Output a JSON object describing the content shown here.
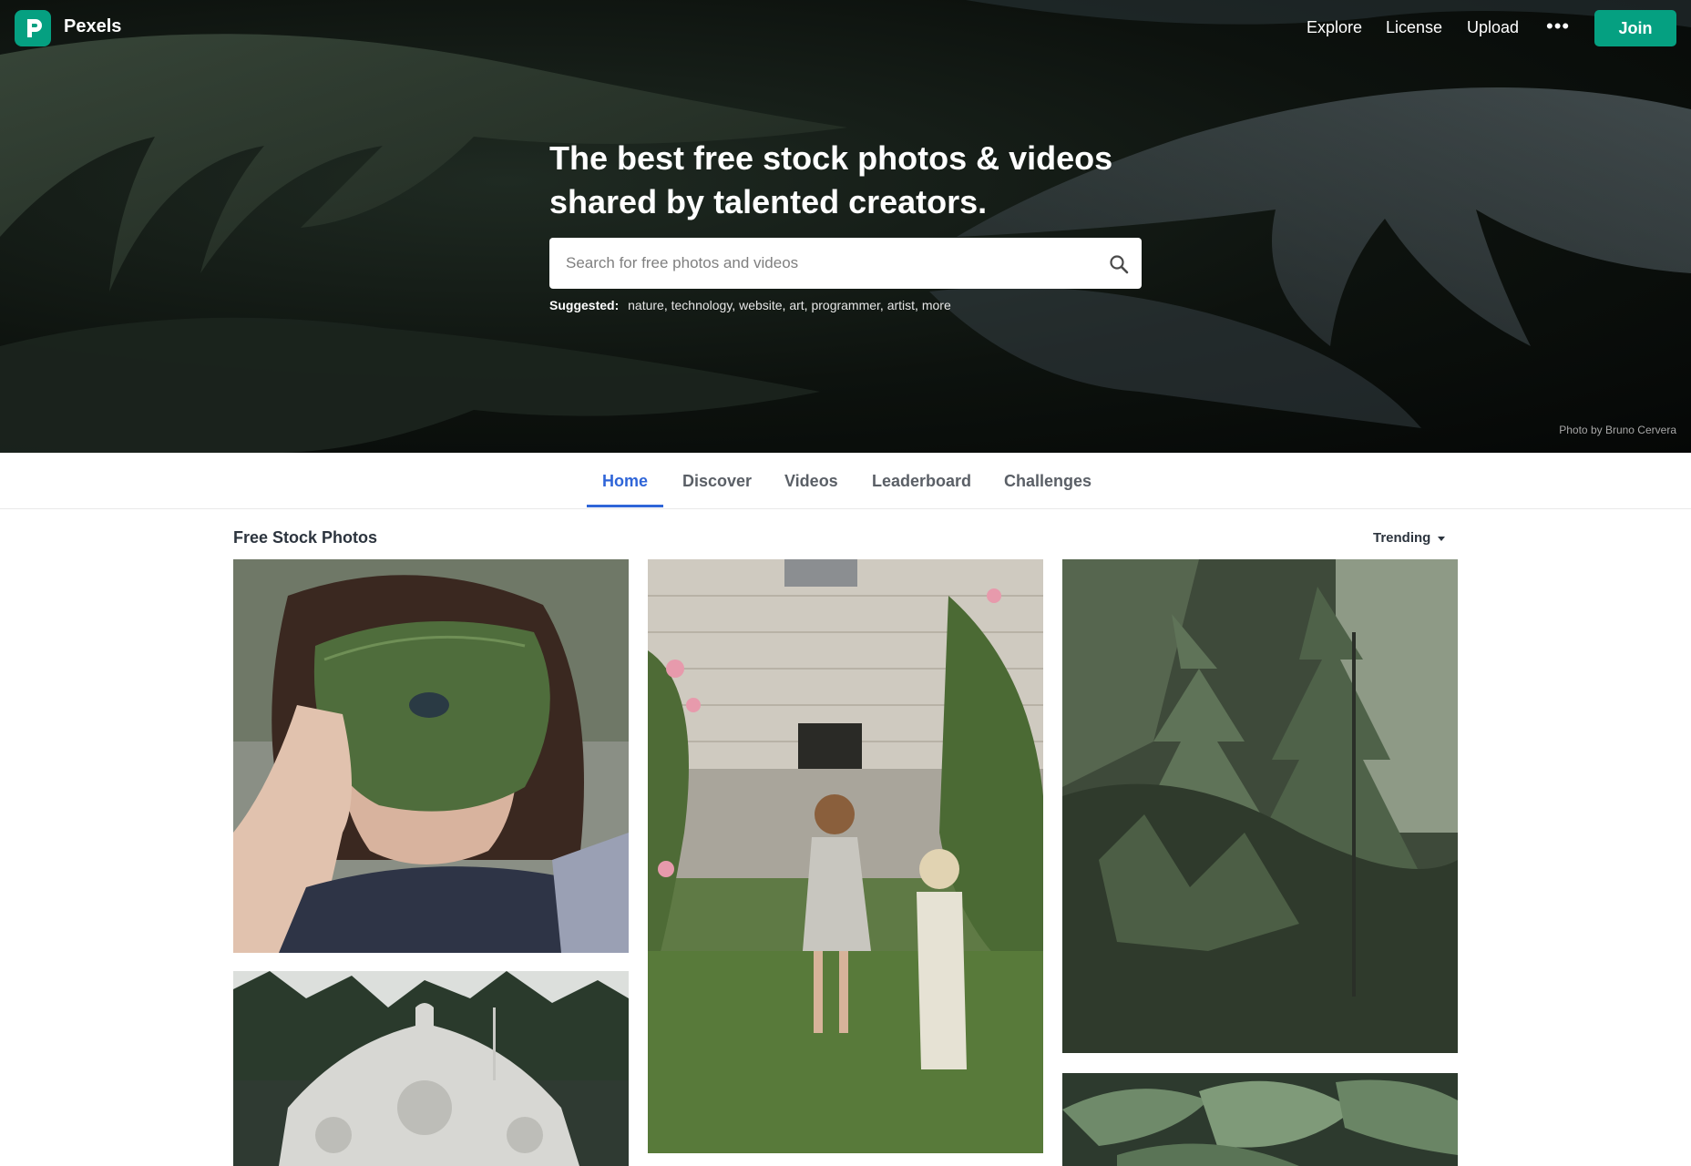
{
  "app": {
    "brand": "Pexels",
    "nav": [
      "Explore",
      "License",
      "Upload"
    ],
    "more_label": "•••",
    "join_label": "Join"
  },
  "hero": {
    "title": "The best free stock photos & videos shared by talented creators.",
    "search_placeholder": "Search for free photos and videos",
    "suggested_label": "Suggested:",
    "suggested_tags": [
      "nature",
      "technology",
      "website",
      "art",
      "programmer",
      "artist",
      "more"
    ],
    "photo_credit": "Photo by Bruno Cervera"
  },
  "tabs": [
    {
      "label": "Home",
      "active": true
    },
    {
      "label": "Discover",
      "active": false
    },
    {
      "label": "Videos",
      "active": false
    },
    {
      "label": "Leaderboard",
      "active": false
    },
    {
      "label": "Challenges",
      "active": false
    }
  ],
  "feed": {
    "title": "Free Stock Photos",
    "sort_label": "Trending"
  },
  "colors": {
    "brand": "#05a081",
    "active_tab": "#2f65d8"
  }
}
